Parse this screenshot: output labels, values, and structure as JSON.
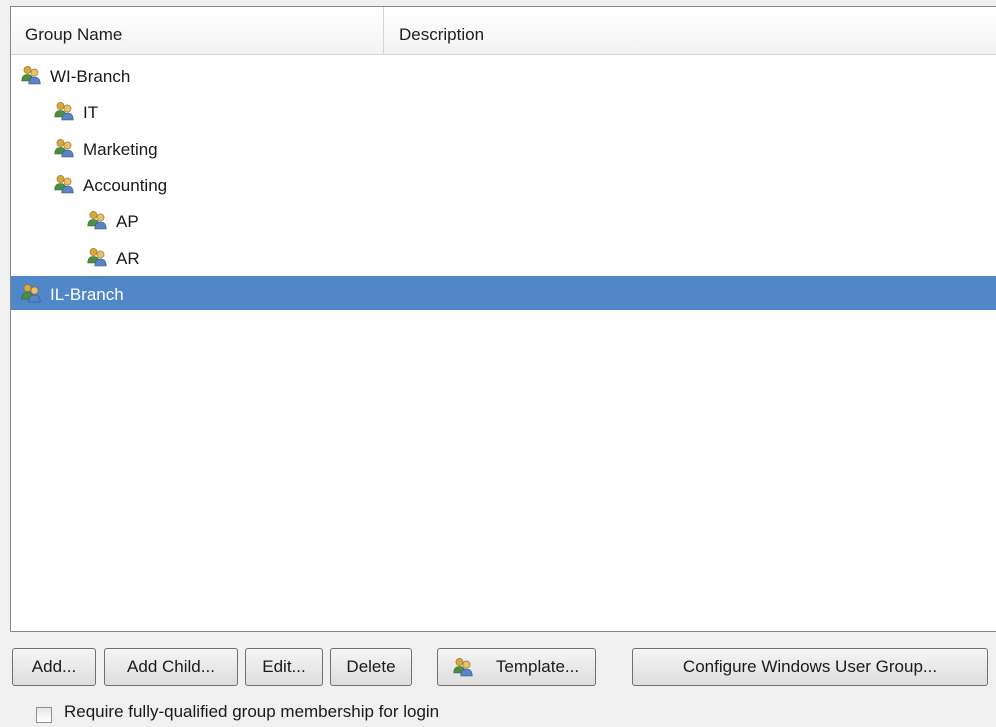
{
  "columns": {
    "name": "Group Name",
    "description": "Description"
  },
  "groups": [
    {
      "label": "WI-Branch",
      "level": 0,
      "selected": false,
      "icon": "user-group-icon"
    },
    {
      "label": "IT",
      "level": 1,
      "selected": false,
      "icon": "user-group-icon"
    },
    {
      "label": "Marketing",
      "level": 1,
      "selected": false,
      "icon": "user-group-icon"
    },
    {
      "label": "Accounting",
      "level": 1,
      "selected": false,
      "icon": "user-group-icon"
    },
    {
      "label": "AP",
      "level": 2,
      "selected": false,
      "icon": "user-group-icon"
    },
    {
      "label": "AR",
      "level": 2,
      "selected": false,
      "icon": "user-group-icon"
    },
    {
      "label": "IL-Branch",
      "level": 0,
      "selected": true,
      "icon": "user-group-icon"
    }
  ],
  "buttons": {
    "add": "Add...",
    "add_child": "Add Child...",
    "edit": "Edit...",
    "delete": "Delete",
    "template": "Template...",
    "configure": "Configure Windows User Group..."
  },
  "options": {
    "require_fq_label": "Require fully-qualified group membership for login",
    "require_fq_checked": false
  },
  "colors": {
    "selection": "#4f87c9",
    "icon_left_user": "#c9a13a",
    "icon_right_user": "#4b8a3c"
  }
}
